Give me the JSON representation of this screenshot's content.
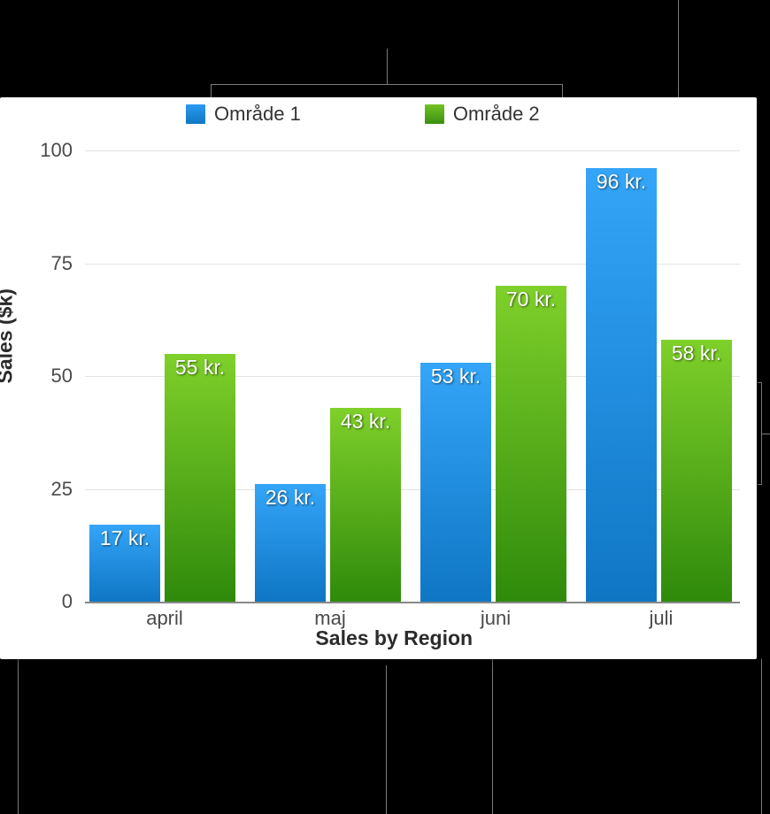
{
  "chart_data": {
    "type": "bar",
    "title": "",
    "xlabel": "Sales by Region",
    "ylabel": "Sales ($k)",
    "ylim": [
      0,
      100
    ],
    "yticks": [
      0,
      25,
      50,
      75,
      100
    ],
    "categories": [
      "april",
      "maj",
      "juni",
      "juli"
    ],
    "series": [
      {
        "name": "Område 1",
        "color": "#2b9af3",
        "values": [
          17,
          26,
          53,
          96
        ]
      },
      {
        "name": "Område 2",
        "color": "#62b91c",
        "values": [
          55,
          43,
          70,
          58
        ]
      }
    ],
    "value_suffix": " kr.",
    "legend_position": "top"
  },
  "legend": {
    "s1": "Område 1",
    "s2": "Område 2"
  },
  "yaxis": {
    "t0": "0",
    "t25": "25",
    "t50": "50",
    "t75": "75",
    "t100": "100",
    "title": "Sales ($k)"
  },
  "xaxis": {
    "c0": "april",
    "c1": "maj",
    "c2": "juni",
    "c3": "juli",
    "title": "Sales by Region"
  },
  "labels": {
    "a0": "17 kr.",
    "a1": "26 kr.",
    "a2": "53 kr.",
    "a3": "96 kr.",
    "b0": "55 kr.",
    "b1": "43 kr.",
    "b2": "70 kr.",
    "b3": "58 kr."
  }
}
